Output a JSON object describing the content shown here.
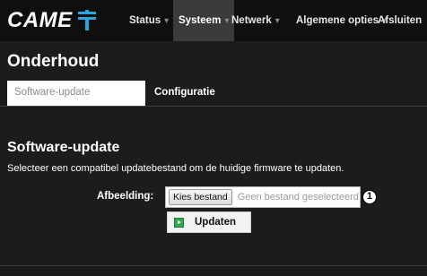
{
  "header": {
    "logo_text": "CAME",
    "nav": [
      {
        "label": "Status",
        "has_caret": true
      },
      {
        "label": "Systeem",
        "has_caret": true,
        "active": true
      },
      {
        "label": "Netwerk",
        "has_caret": true
      },
      {
        "label": "Algemene opties",
        "has_caret": true
      },
      {
        "label": "Afsluiten",
        "has_caret": false
      }
    ],
    "caret_glyph": "▾"
  },
  "page": {
    "title": "Onderhoud",
    "tabs": [
      {
        "label": "Software-update",
        "active": true
      },
      {
        "label": "Configuratie",
        "active": false
      }
    ]
  },
  "section": {
    "title": "Software-update",
    "description": "Selecteer een compatibel updatebestand om de huidige firmware te updaten.",
    "file_label": "Afbeelding:",
    "file_button": "Kies bestand",
    "file_status": "Geen bestand geselecteerd",
    "callout_number": "1",
    "update_button": "Updaten"
  },
  "colors": {
    "background": "#1c1c1c",
    "topbar": "#0f0f0f",
    "active_nav": "#3b3b3b",
    "logo_accent": "#2aa6df",
    "update_icon": "#34a853"
  },
  "icons": {
    "logo_mark": "came-logo-icon",
    "update": "play-icon",
    "callout": "numbered-callout-icon"
  }
}
